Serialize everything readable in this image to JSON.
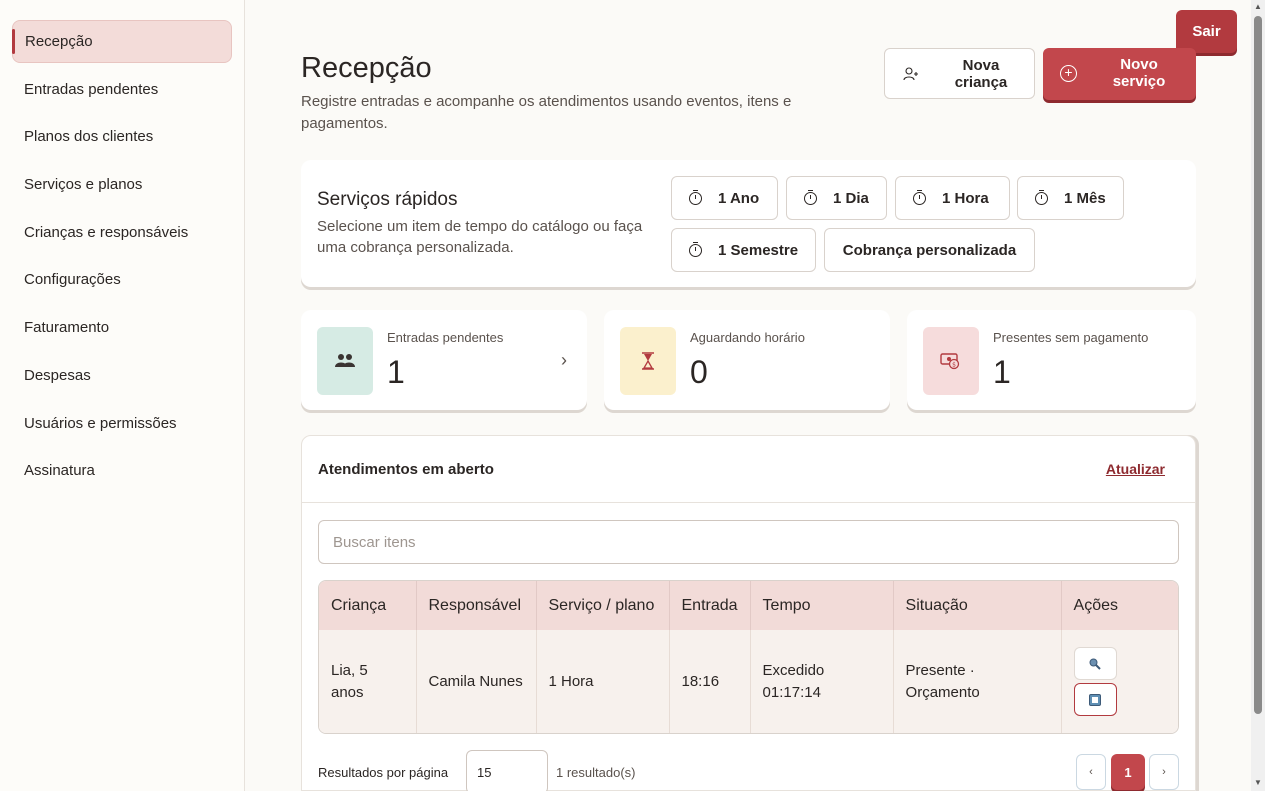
{
  "sidebar": {
    "items": [
      {
        "label": "Recepção"
      },
      {
        "label": "Entradas pendentes"
      },
      {
        "label": "Planos dos clientes"
      },
      {
        "label": "Serviços e planos"
      },
      {
        "label": "Crianças e responsáveis"
      },
      {
        "label": "Configurações"
      },
      {
        "label": "Faturamento"
      },
      {
        "label": "Despesas"
      },
      {
        "label": "Usuários e permissões"
      },
      {
        "label": "Assinatura"
      }
    ]
  },
  "header": {
    "logout_label": "Sair",
    "title": "Recepção",
    "subtitle": "Registre entradas e acompanhe os atendimentos usando eventos, itens e pagamentos.",
    "new_child_label": "Nova criança",
    "new_service_label": "Novo serviço"
  },
  "quick_services": {
    "title": "Serviços rápidos",
    "description": "Selecione um item de tempo do catálogo ou faça uma cobrança personalizada.",
    "options": [
      "1 Ano",
      "1 Dia",
      "1 Hora",
      "1 Mês",
      "1 Semestre"
    ],
    "custom_label": "Cobrança personalizada"
  },
  "stats": [
    {
      "label": "Entradas pendentes",
      "value": "1",
      "icon": "people-icon"
    },
    {
      "label": "Aguardando horário",
      "value": "0",
      "icon": "hourglass-icon"
    },
    {
      "label": "Presentes sem pagamento",
      "value": "1",
      "icon": "money-icon"
    }
  ],
  "open_services": {
    "title": "Atendimentos em aberto",
    "refresh_label": "Atualizar",
    "search_placeholder": "Buscar itens",
    "columns": [
      "Criança",
      "Responsável",
      "Serviço / plano",
      "Entrada",
      "Tempo",
      "Situação",
      "Ações"
    ],
    "rows": [
      {
        "child": "Lia, 5 anos",
        "guardian": "Camila Nunes",
        "service": "1 Hora",
        "entry": "18:16",
        "time": "Excedido 01:17:14",
        "status": "Presente · Orçamento"
      }
    ],
    "per_page_label": "Resultados por página",
    "per_page_value": "15",
    "results_text": "1 resultado(s)",
    "pagination": {
      "prev": "‹",
      "current": "1",
      "next": "›"
    }
  },
  "colors": {
    "accent": "#c2474c",
    "accent_dark": "#8e2a2f",
    "active_nav_bg": "#f3dcd9",
    "table_header_bg": "#f2dbd8"
  }
}
